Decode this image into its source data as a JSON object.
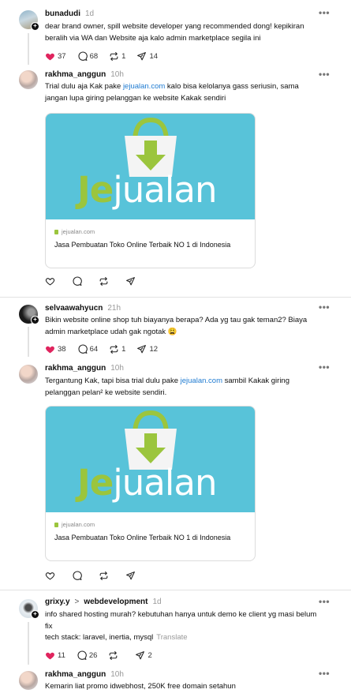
{
  "icons": {
    "heart": "heart-icon",
    "comment": "comment-icon",
    "repost": "repost-icon",
    "share": "share-icon",
    "more": "more-icon"
  },
  "colors": {
    "like_active": "#e0245e",
    "link": "#1f7bd1",
    "card_bg": "#58c3d9",
    "logo_green": "#9bc53d",
    "logo_white": "#ffffff"
  },
  "more_glyph": "•••",
  "posts": [
    {
      "username": "bunadudi",
      "time": "1d",
      "text": "dear brand owner, spill website developer yang recommended dong! kepikiran beralih via WA dan Website aja kalo admin marketplace segila ini",
      "likes": "37",
      "comments": "68",
      "reposts": "1",
      "shares": "14"
    },
    {
      "username": "rakhma_anggun",
      "time": "10h",
      "text_before": "Trial dulu aja Kak pake ",
      "link": "jejualan.com",
      "text_after": " kalo bisa kelolanya gass seriusin, sama jangan lupa giring pelanggan ke website Kakak sendiri",
      "card": {
        "logo_je": "Je",
        "logo_jualan": "jualan",
        "domain": "jejualan.com",
        "title": "Jasa Pembuatan Toko Online Terbaik NO 1 di Indonesia"
      }
    },
    {
      "username": "selvaawahyucn",
      "time": "21h",
      "text": "Bikin website online shop tuh biayanya berapa? Ada yg tau gak teman2? Biaya admin marketplace udah gak ngotak 😩",
      "likes": "38",
      "comments": "64",
      "reposts": "1",
      "shares": "12"
    },
    {
      "username": "rakhma_anggun",
      "time": "10h",
      "text_before": "Tergantung Kak, tapi bisa trial dulu pake ",
      "link": "jejualan.com",
      "text_after": " sambil Kakak giring pelanggan pelan² ke website sendiri.",
      "card": {
        "logo_je": "Je",
        "logo_jualan": "jualan",
        "domain": "jejualan.com",
        "title": "Jasa Pembuatan Toko Online Terbaik NO 1 di Indonesia"
      }
    },
    {
      "username": "grixy.y",
      "separator": ">",
      "community": "webdevelopment",
      "time": "1d",
      "text_line1": "info shared hosting murah? kebutuhan hanya untuk demo ke client yg masi belum fix",
      "text_line2": "tech stack: laravel, inertia, mysql",
      "translate": "Translate",
      "likes": "11",
      "comments": "26",
      "reposts": "",
      "shares": "2"
    },
    {
      "username": "rakhma_anggun",
      "time": "10h",
      "text": "Kemarin liat promo idwebhost, 250K free domain setahun"
    }
  ]
}
